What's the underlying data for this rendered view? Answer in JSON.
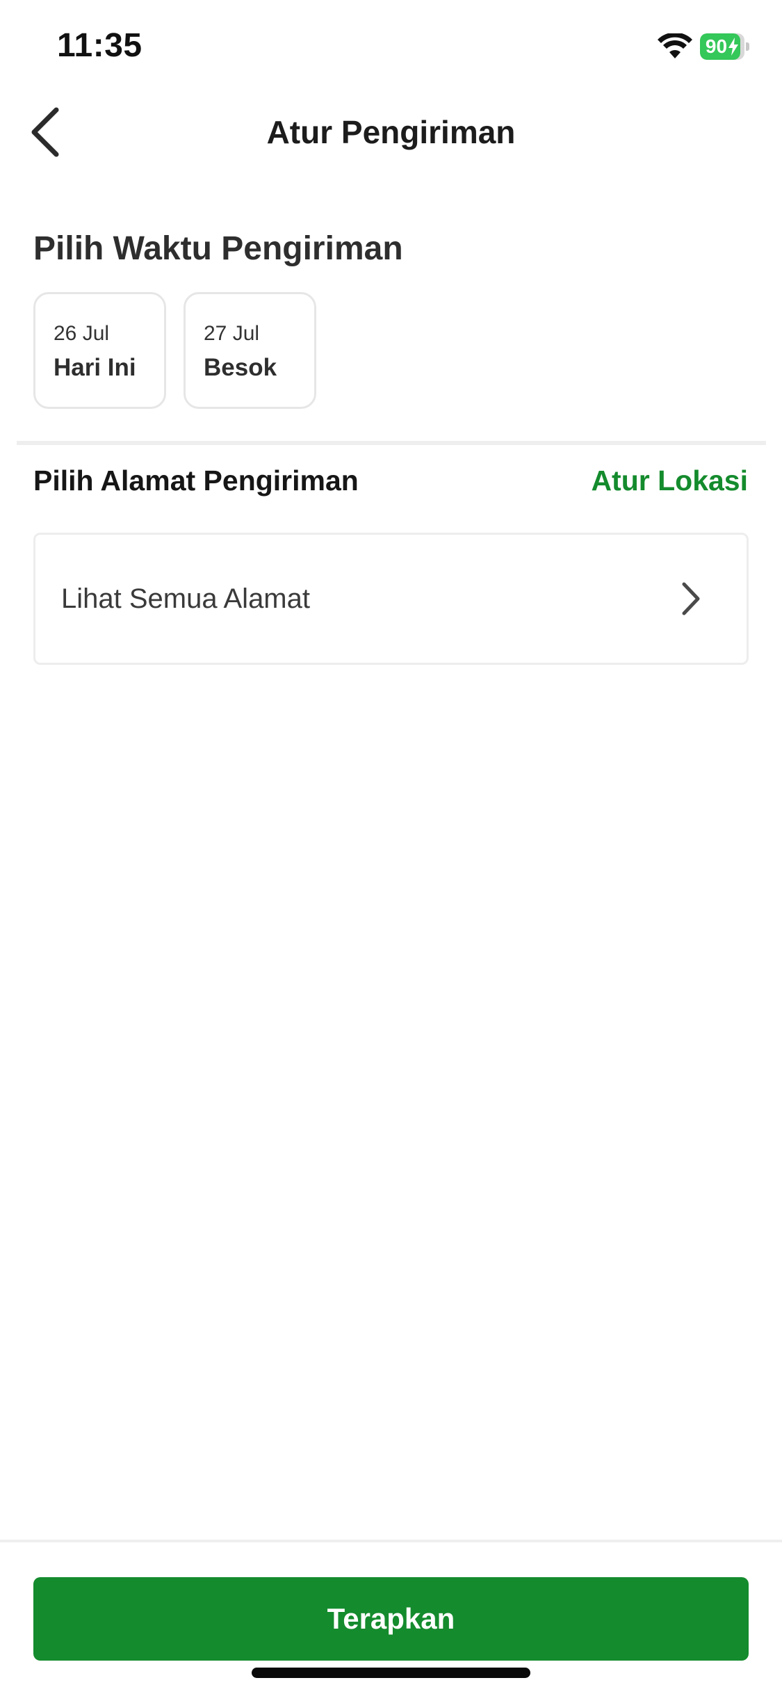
{
  "status_bar": {
    "time": "11:35",
    "battery_level": 90,
    "battery_label": "90",
    "icons": [
      "wifi-icon",
      "battery-icon",
      "charging-bolt-icon"
    ]
  },
  "header": {
    "title": "Atur Pengiriman",
    "back_icon": "chevron-left-icon"
  },
  "delivery_time": {
    "title": "Pilih Waktu Pengiriman",
    "options": [
      {
        "date": "26 Jul",
        "label": "Hari Ini"
      },
      {
        "date": "27 Jul",
        "label": "Besok"
      }
    ]
  },
  "delivery_address": {
    "title": "Pilih Alamat Pengiriman",
    "action_label": "Atur Lokasi",
    "see_all_label": "Lihat Semua Alamat",
    "see_all_icon": "chevron-right-icon"
  },
  "footer": {
    "apply_label": "Terapkan"
  },
  "colors": {
    "brand_green": "#148b2d",
    "battery_green": "#34c759",
    "text_dark": "#2e2e2e",
    "border": "#e6e6e6"
  }
}
